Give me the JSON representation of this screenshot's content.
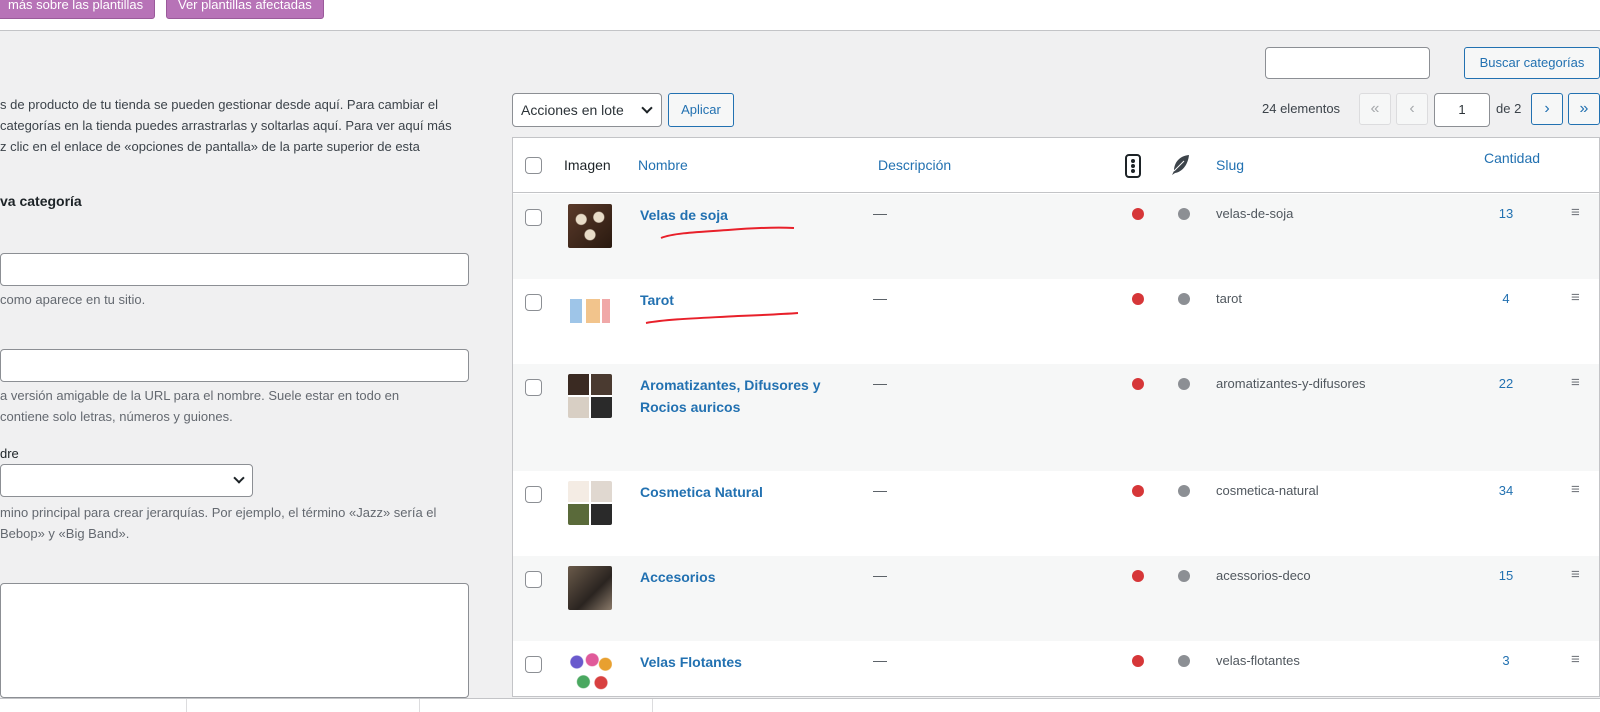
{
  "notice": {
    "buttons": [
      "más sobre las plantillas",
      "Ver plantillas afectadas"
    ]
  },
  "search": {
    "input_value": "",
    "button_label": "Buscar categorías"
  },
  "left": {
    "description_lines": [
      "s de producto de tu tienda se pueden gestionar desde aquí. Para cambiar el",
      "categorías en la tienda puedes arrastrarlas y soltarlas aquí. Para ver aquí más",
      "z clic en el enlace de «opciones de pantalla» de la parte superior de esta"
    ],
    "section_title": "va categoría",
    "name_help": "como aparece en tu sitio.",
    "slug_help_lines": [
      "a versión amigable de la URL para el nombre. Suele estar en todo en",
      "contiene solo letras, números y guiones."
    ],
    "parent_label": "dre",
    "parent_help_lines": [
      "mino principal para crear jerarquías. Por ejemplo, el término «Jazz» sería el",
      "Bebop» y «Big Band»."
    ]
  },
  "toolbar": {
    "bulk_actions": "Acciones en lote",
    "apply": "Aplicar",
    "items_count": "24 elementos",
    "first": "«",
    "prev": "‹",
    "current_page": "1",
    "of_pages": "de 2",
    "next": "›",
    "last": "»"
  },
  "table": {
    "headers": {
      "image": "Imagen",
      "name": "Nombre",
      "description": "Descripción",
      "slug": "Slug",
      "count": "Cantidad"
    },
    "rows": [
      {
        "name": "Velas de soja",
        "description": "—",
        "slug": "velas-de-soja",
        "count": "13",
        "underlined": true
      },
      {
        "name": "Tarot",
        "description": "—",
        "slug": "tarot",
        "count": "4",
        "underlined": true
      },
      {
        "name": "Aromatizantes, Difusores y Rocios auricos",
        "description": "—",
        "slug": "aromatizantes-y-difusores",
        "count": "22"
      },
      {
        "name": "Cosmetica Natural",
        "description": "—",
        "slug": "cosmetica-natural",
        "count": "34"
      },
      {
        "name": "Accesorios",
        "description": "—",
        "slug": "acessorios-deco",
        "count": "15"
      },
      {
        "name": "Velas Flotantes",
        "description": "—",
        "slug": "velas-flotantes",
        "count": "3"
      }
    ]
  },
  "colors": {
    "link": "#2271b1",
    "purple_button": "#b773b7",
    "status_red": "#d63638",
    "status_gray": "#8c8f94",
    "annotation_red": "#e8202a"
  }
}
